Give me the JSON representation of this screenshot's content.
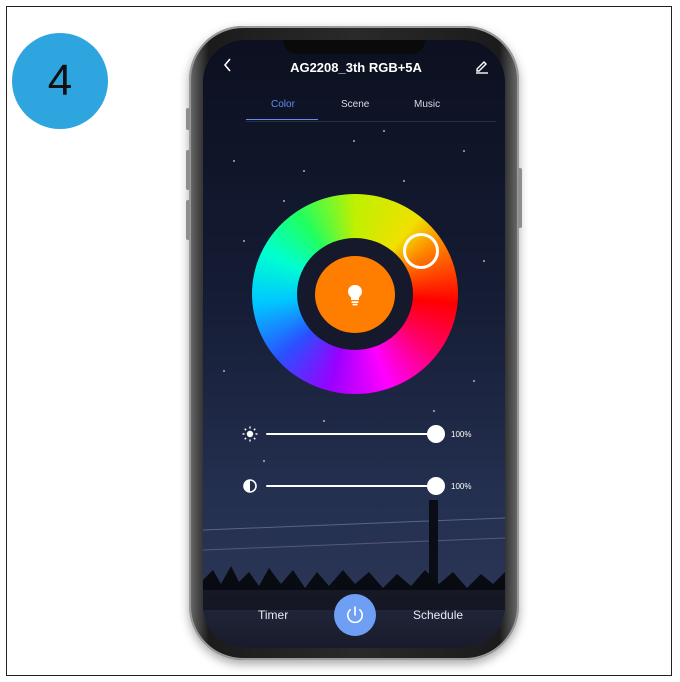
{
  "step_badge": "4",
  "header": {
    "title": "AG2208_3th RGB+5A",
    "back_icon": "chevron-left-icon",
    "edit_icon": "pencil-icon"
  },
  "tabs": [
    {
      "label": "Color",
      "active": true
    },
    {
      "label": "Scene",
      "active": false
    },
    {
      "label": "Music",
      "active": false
    }
  ],
  "color_wheel": {
    "selected_color": "#ff7e00",
    "center_icon": "lightbulb-icon"
  },
  "sliders": [
    {
      "icon": "sun-brightness-icon",
      "value": "100%",
      "level": 1.0
    },
    {
      "icon": "contrast-icon",
      "value": "100%",
      "level": 1.0
    }
  ],
  "bottom_bar": {
    "timer_label": "Timer",
    "schedule_label": "Schedule",
    "power_icon": "power-icon"
  },
  "colors": {
    "accent": "#5f8ff0",
    "badge": "#2fa5df",
    "power_button": "#6f9ef5",
    "bulb": "#ff7e00"
  }
}
